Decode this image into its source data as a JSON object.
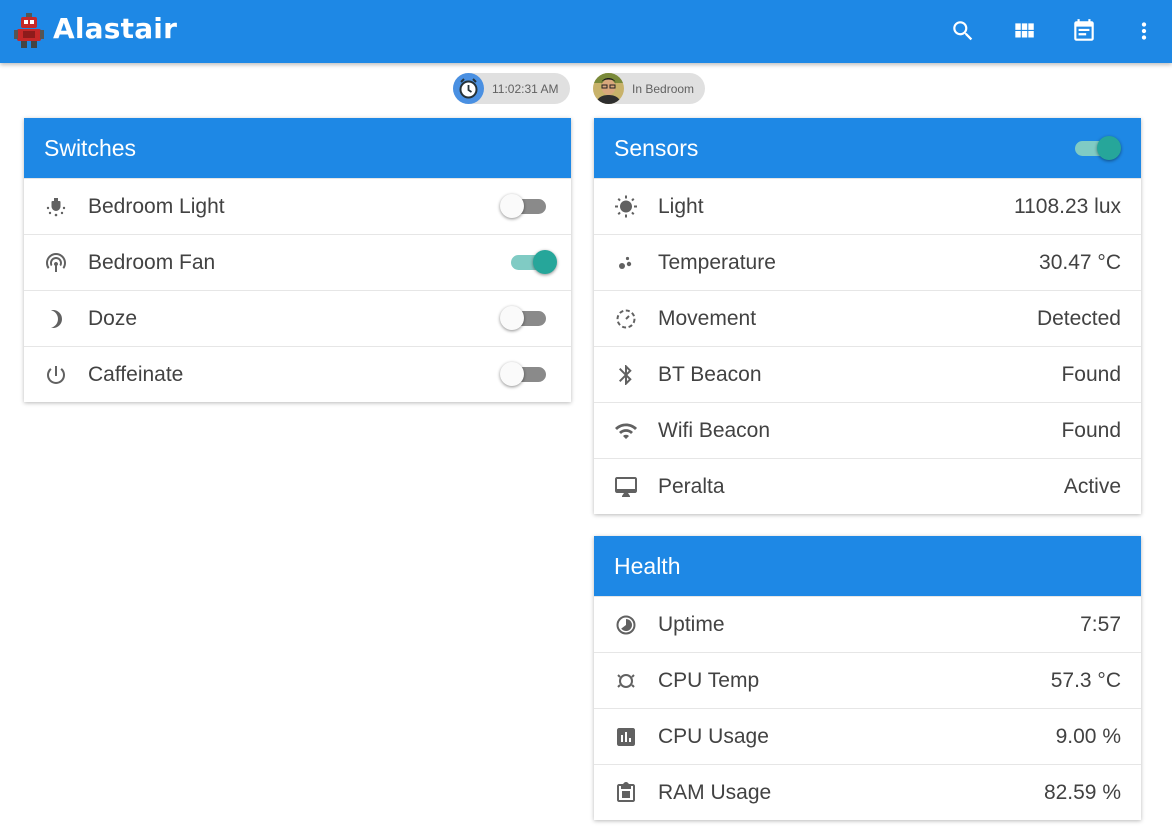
{
  "app": {
    "title": "Alastair",
    "accent_color": "#1e88e5",
    "toolbar_icons": [
      "search-icon",
      "view-module-icon",
      "calendar-icon",
      "more-vert-icon"
    ]
  },
  "badges": {
    "clock": {
      "text": "11:02:31 AM",
      "icon": "alarm-clock-icon"
    },
    "presence": {
      "text": "In Bedroom",
      "icon": "avatar"
    }
  },
  "switches": {
    "title": "Switches",
    "items": [
      {
        "label": "Bedroom Light",
        "icon": "light-icon",
        "on": false
      },
      {
        "label": "Bedroom Fan",
        "icon": "fan-icon",
        "on": true
      },
      {
        "label": "Doze",
        "icon": "moon-icon",
        "on": false
      },
      {
        "label": "Caffeinate",
        "icon": "power-icon",
        "on": false
      }
    ]
  },
  "sensors": {
    "title": "Sensors",
    "header_toggle_on": true,
    "items": [
      {
        "label": "Light",
        "value": "1108.23 lux",
        "icon": "brightness-icon"
      },
      {
        "label": "Temperature",
        "value": "30.47 °C",
        "icon": "temperature-dots-icon"
      },
      {
        "label": "Movement",
        "value": "Detected",
        "icon": "motion-icon"
      },
      {
        "label": "BT Beacon",
        "value": "Found",
        "icon": "bluetooth-icon"
      },
      {
        "label": "Wifi Beacon",
        "value": "Found",
        "icon": "wifi-icon"
      },
      {
        "label": "Peralta",
        "value": "Active",
        "icon": "desktop-icon"
      }
    ]
  },
  "health": {
    "title": "Health",
    "items": [
      {
        "label": "Uptime",
        "value": "7:57",
        "icon": "uptime-icon"
      },
      {
        "label": "CPU Temp",
        "value": "57.3 °C",
        "icon": "cpu-temp-icon"
      },
      {
        "label": "CPU Usage",
        "value": "9.00 %",
        "icon": "chart-icon"
      },
      {
        "label": "RAM Usage",
        "value": "82.59 %",
        "icon": "memory-icon"
      }
    ]
  }
}
